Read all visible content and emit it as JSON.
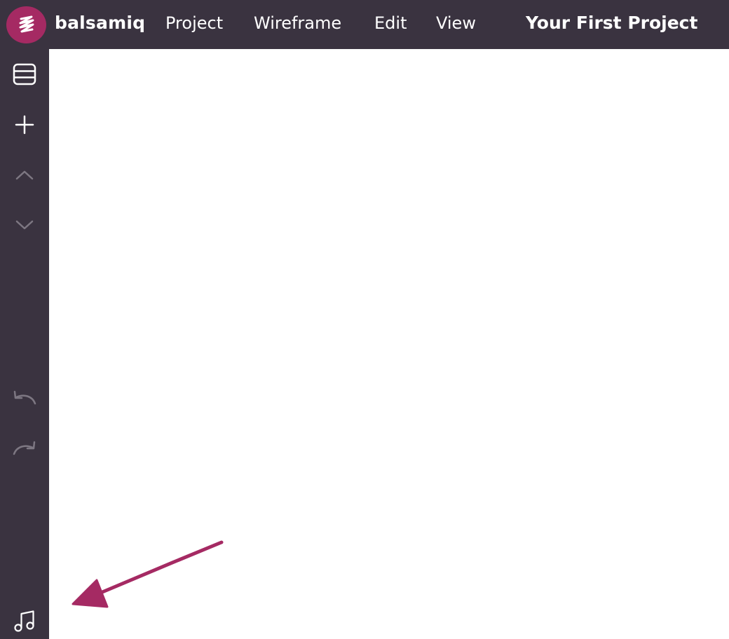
{
  "app": {
    "brand": "balsamiq",
    "project_title": "Your First Project",
    "accent_color": "#a52a63",
    "chrome_color": "#3a3340"
  },
  "menu": [
    {
      "label": "Project"
    },
    {
      "label": "Wireframe"
    },
    {
      "label": "Edit"
    },
    {
      "label": "View"
    }
  ],
  "sidebar": {
    "items": [
      {
        "icon": "wireframe-list-icon",
        "enabled": true
      },
      {
        "icon": "plus-icon",
        "enabled": true
      },
      {
        "icon": "chevron-up-icon",
        "enabled": false
      },
      {
        "icon": "chevron-down-icon",
        "enabled": false
      },
      {
        "icon": "undo-icon",
        "enabled": false
      },
      {
        "icon": "redo-icon",
        "enabled": false
      },
      {
        "icon": "music-note-icon",
        "enabled": true
      }
    ]
  },
  "annotation": {
    "type": "arrow",
    "color": "#a52a63",
    "points_to": "music-note-icon"
  }
}
